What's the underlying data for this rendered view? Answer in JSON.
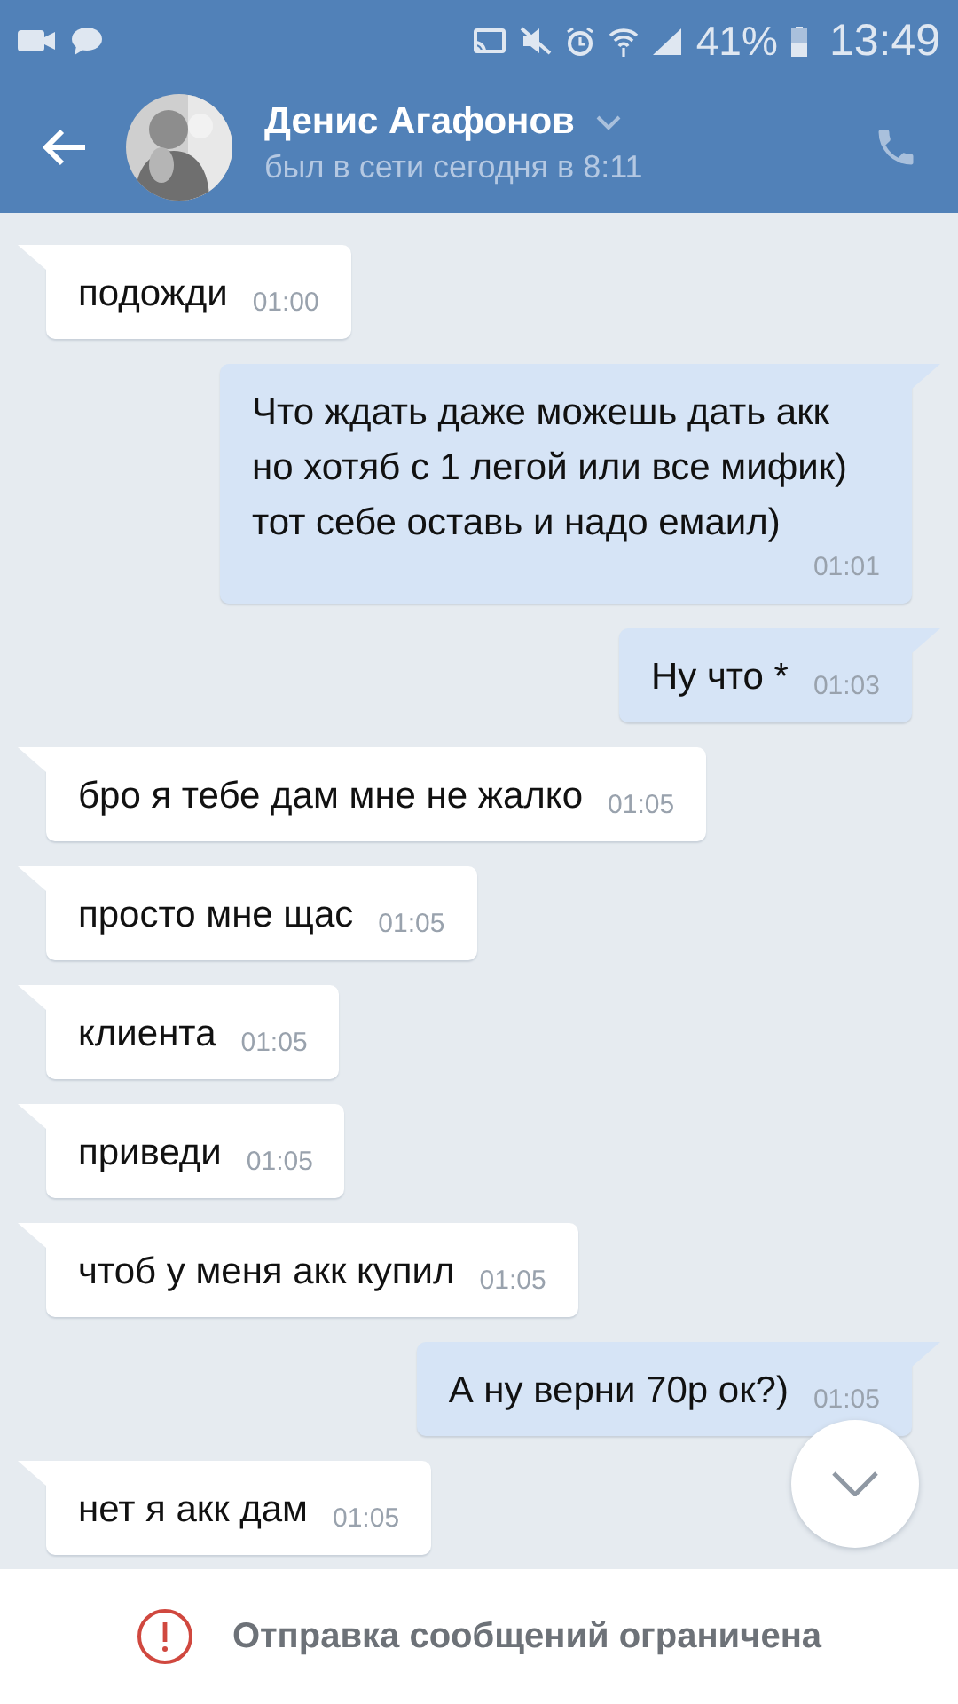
{
  "status_bar": {
    "battery_text": "41%",
    "time": "13:49"
  },
  "header": {
    "name": "Денис Агафонов",
    "status": "был в сети сегодня в 8:11"
  },
  "messages": [
    {
      "kind": "in",
      "text": "подожди",
      "time": "01:00"
    },
    {
      "kind": "out",
      "text": "Что ждать даже можешь дать акк но хотяб с 1 легой или все мифик) тот себе оставь и надо емаил)",
      "time": "01:01"
    },
    {
      "kind": "out",
      "text": "Ну что *",
      "time": "01:03"
    },
    {
      "kind": "in",
      "text": "бро я тебе дам мне не жалко",
      "time": "01:05"
    },
    {
      "kind": "in",
      "text": "просто мне щас",
      "time": "01:05"
    },
    {
      "kind": "in",
      "text": "клиента",
      "time": "01:05"
    },
    {
      "kind": "in",
      "text": "приведи",
      "time": "01:05"
    },
    {
      "kind": "in",
      "text": "чтоб у меня акк купил",
      "time": "01:05"
    },
    {
      "kind": "out",
      "text": "А ну верни 70р ок?)",
      "time": "01:05"
    },
    {
      "kind": "in",
      "text": "нет я акк дам",
      "time": "01:05"
    }
  ],
  "notice": "Отправка сообщений ограничена"
}
